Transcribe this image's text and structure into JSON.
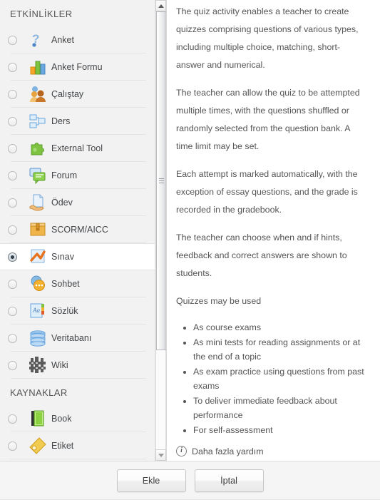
{
  "dialog": {
    "left_panel": {
      "groups": [
        {
          "title": "ETKİNLİKLER",
          "items": [
            {
              "label": "Anket",
              "icon": "question-mark-icon",
              "selected": false
            },
            {
              "label": "Anket Formu",
              "icon": "bar-chart-icon",
              "selected": false
            },
            {
              "label": "Çalıştay",
              "icon": "people-workshop-icon",
              "selected": false
            },
            {
              "label": "Ders",
              "icon": "lesson-flowchart-icon",
              "selected": false
            },
            {
              "label": "External Tool",
              "icon": "puzzle-piece-icon",
              "selected": false
            },
            {
              "label": "Forum",
              "icon": "speech-bubbles-icon",
              "selected": false
            },
            {
              "label": "Ödev",
              "icon": "hand-document-icon",
              "selected": false
            },
            {
              "label": "SCORM/AICC",
              "icon": "package-box-icon",
              "selected": false
            },
            {
              "label": "Sınav",
              "icon": "checkmark-page-icon",
              "selected": true
            },
            {
              "label": "Sohbet",
              "icon": "chat-bubbles-icon",
              "selected": false
            },
            {
              "label": "Sözlük",
              "icon": "glossary-book-icon",
              "selected": false
            },
            {
              "label": "Veritabanı",
              "icon": "database-icon",
              "selected": false
            },
            {
              "label": "Wiki",
              "icon": "wiki-blocks-icon",
              "selected": false
            }
          ]
        },
        {
          "title": "KAYNAKLAR",
          "items": [
            {
              "label": "Book",
              "icon": "green-book-icon",
              "selected": false
            },
            {
              "label": "Etiket",
              "icon": "label-tag-icon",
              "selected": false
            }
          ]
        }
      ]
    },
    "description": {
      "paragraphs": [
        "The quiz activity enables a teacher to create quizzes comprising questions of various types, including multiple choice, matching, short-answer and numerical.",
        "The teacher can allow the quiz to be attempted multiple times, with the questions shuffled or randomly selected from the question bank. A time limit may be set.",
        "Each attempt is marked automatically, with the exception of essay questions, and the grade is recorded in the gradebook.",
        "The teacher can choose when and if hints, feedback and correct answers are shown to students.",
        "Quizzes may be used"
      ],
      "bullets": [
        "As course exams",
        "As mini tests for reading assignments or at the end of a topic",
        "As exam practice using questions from past exams",
        "To deliver immediate feedback about performance",
        "For self-assessment"
      ],
      "help_link": "Daha fazla yardım",
      "help_icon": "info-circle-icon"
    },
    "footer": {
      "add_label": "Ekle",
      "cancel_label": "İptal"
    },
    "scrollbar": {
      "up_icon": "scroll-up-arrow-icon",
      "down_icon": "scroll-down-arrow-icon"
    },
    "colors": {
      "panel_background": "#f2f2f2",
      "selected_row": "#ffffff",
      "text": "#555555",
      "footer_background": "#f5f5f5"
    }
  }
}
